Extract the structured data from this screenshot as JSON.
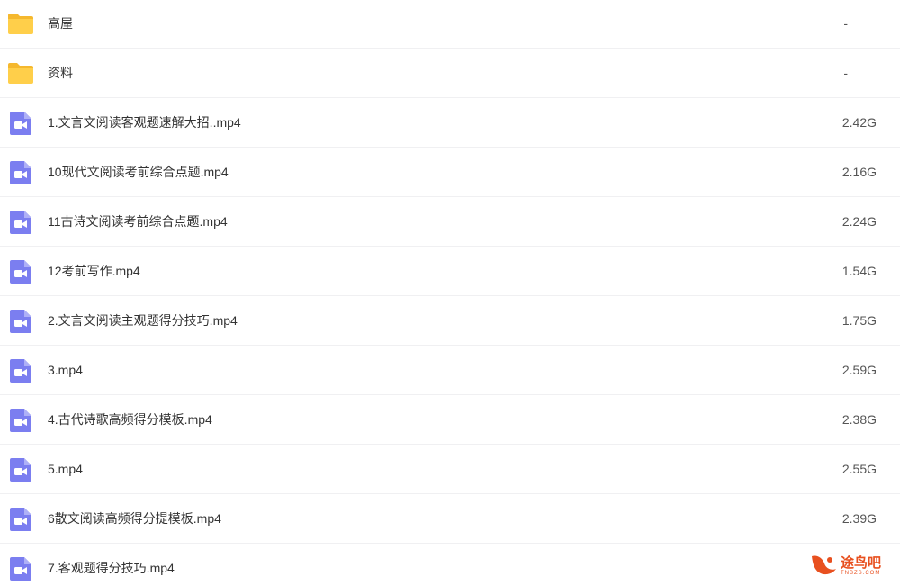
{
  "files": [
    {
      "type": "folder",
      "icon": "folder-icon",
      "name": "高屋",
      "size": "-"
    },
    {
      "type": "folder",
      "icon": "folder-icon",
      "name": "资料",
      "size": "-"
    },
    {
      "type": "video",
      "icon": "video-file-icon",
      "name": "1.文言文阅读客观题速解大招..mp4",
      "size": "2.42G"
    },
    {
      "type": "video",
      "icon": "video-file-icon",
      "name": "10现代文阅读考前综合点题.mp4",
      "size": "2.16G"
    },
    {
      "type": "video",
      "icon": "video-file-icon",
      "name": "11古诗文阅读考前综合点题.mp4",
      "size": "2.24G"
    },
    {
      "type": "video",
      "icon": "video-file-icon",
      "name": "12考前写作.mp4",
      "size": "1.54G"
    },
    {
      "type": "video",
      "icon": "video-file-icon",
      "name": "2.文言文阅读主观题得分技巧.mp4",
      "size": "1.75G"
    },
    {
      "type": "video",
      "icon": "video-file-icon",
      "name": "3.mp4",
      "size": "2.59G"
    },
    {
      "type": "video",
      "icon": "video-file-icon",
      "name": "4.古代诗歌高频得分模板.mp4",
      "size": "2.38G"
    },
    {
      "type": "video",
      "icon": "video-file-icon",
      "name": "5.mp4",
      "size": "2.55G"
    },
    {
      "type": "video",
      "icon": "video-file-icon",
      "name": "6散文阅读高频得分提模板.mp4",
      "size": "2.39G"
    },
    {
      "type": "video",
      "icon": "video-file-icon",
      "name": "7.客观题得分技巧.mp4",
      "size": ""
    }
  ],
  "watermark": {
    "text": "途鸟吧",
    "subtext": "TNBZS.COM"
  },
  "colors": {
    "folder": "#ffcf4a",
    "folder_tab": "#f5b82e",
    "video": "#7b7ef0",
    "row_border": "#f0f0f2"
  }
}
